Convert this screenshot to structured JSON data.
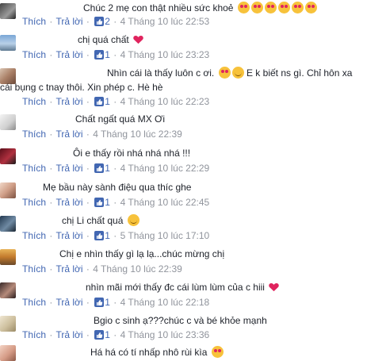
{
  "labels": {
    "like": "Thích",
    "reply": "Trả lời",
    "sep": "·"
  },
  "comments": [
    {
      "text": "Chúc 2 mẹ con thật nhiều sức khoẻ",
      "like_count": "2",
      "time": "4 Tháng 10 lúc 22:53",
      "emoji": "heart-eyes x6"
    },
    {
      "text": "chị quá chất",
      "like_count": "1",
      "time": "4 Tháng 10 lúc 23:23",
      "emoji": "red-heart"
    },
    {
      "text_line1": "Nhìn cái là thấy luôn c ơi.",
      "text_line1b": "E k biết ns gì. Chỉ hôn xa",
      "text_line2": "cái bụng c tnay thôi. Xin phép c. Hè hè",
      "like_count": "1",
      "time": "4 Tháng 10 lúc 22:23",
      "emoji": "kiss-faces"
    },
    {
      "text": "Chất ngất quá MX Ơi",
      "like_count": "",
      "time": "4 Tháng 10 lúc 22:39"
    },
    {
      "text": "Ôi e thấy rồi nhá nhá nhá !!!",
      "like_count": "1",
      "time": "4 Tháng 10 lúc 22:29"
    },
    {
      "text": "Mẹ bầu này sành điệu qua thíc ghe",
      "like_count": "1",
      "time": "4 Tháng 10 lúc 22:45"
    },
    {
      "text": "chị Li chất quá",
      "like_count": "1",
      "time": "5 Tháng 10 lúc 17:10",
      "emoji": "smile"
    },
    {
      "text": "Chị e nhìn thấy gì lạ lạ...chúc mừng chị",
      "like_count": "",
      "time": "4 Tháng 10 lúc 22:39"
    },
    {
      "text": "nhìn mãi mới thấy đc cái lùm lùm của c hiii",
      "like_count": "1",
      "time": "4 Tháng 10 lúc 22:18",
      "emoji": "red-heart"
    },
    {
      "text": "Bgio c sinh ạ???chúc c và bé khỏe mạnh",
      "like_count": "1",
      "time": "4 Tháng 10 lúc 23:36"
    },
    {
      "text": "Há há có tí nhấp nhô rùi kìa",
      "emoji": "heart-eyes"
    }
  ]
}
